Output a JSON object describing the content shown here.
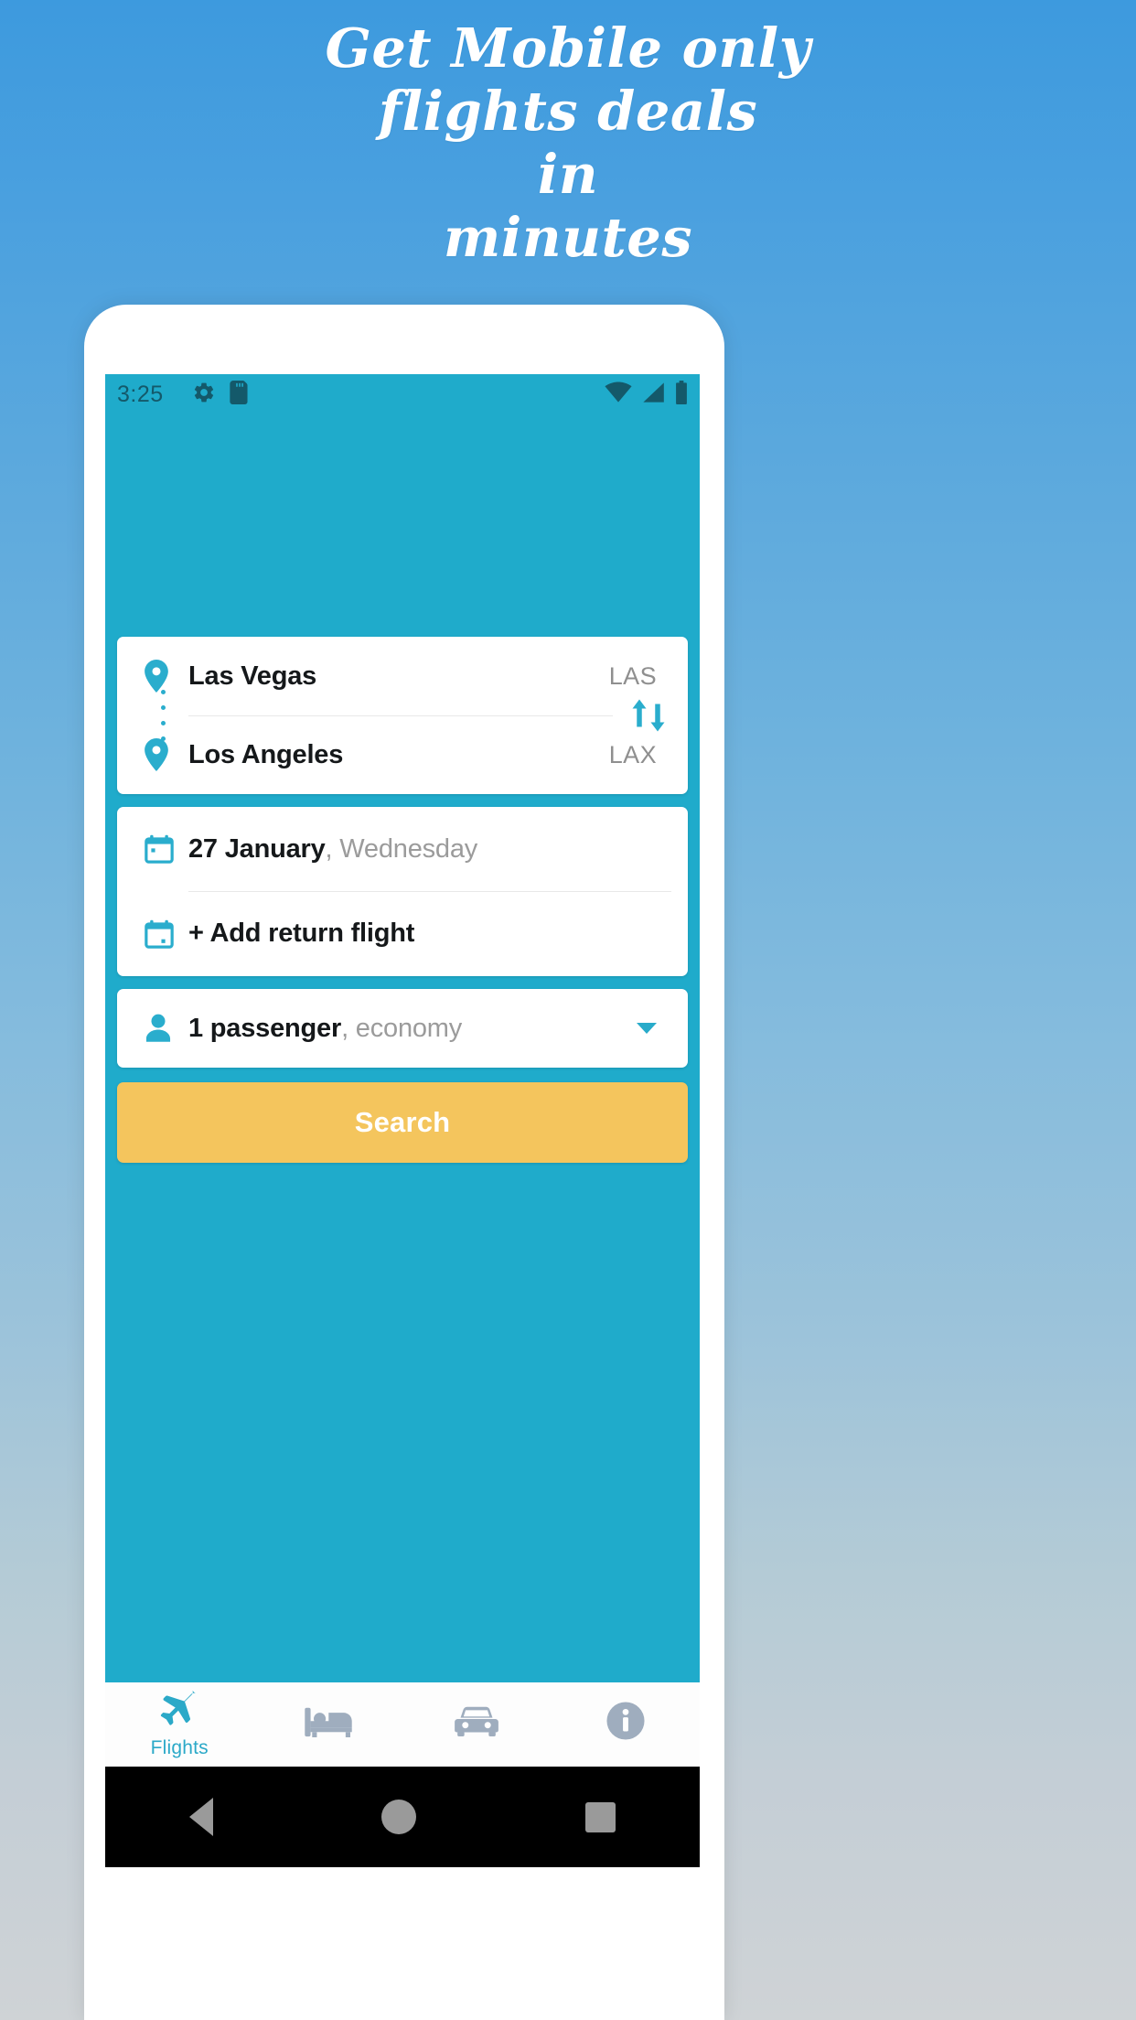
{
  "promo": {
    "lines": [
      "Get Mobile only",
      "flights deals",
      "in",
      "minutes"
    ]
  },
  "colors": {
    "app_teal": "#1fabcb",
    "accent_yellow": "#f4c55d",
    "icon_teal": "#2aadcd",
    "muted_gray": "#9b9b9b",
    "bg_top_blue": "#3d9ade",
    "bg_bottom_gray": "#cfd3d6"
  },
  "status_bar": {
    "time": "3:25",
    "left_icons": [
      "gear-icon",
      "sd-card-icon"
    ],
    "right_icons": [
      "wifi-icon",
      "cellular-signal-icon",
      "battery-icon"
    ]
  },
  "route_card": {
    "origin": {
      "city": "Las Vegas",
      "code": "LAS",
      "icon": "location-pin-icon"
    },
    "destination": {
      "city": "Los Angeles",
      "code": "LAX",
      "icon": "location-pin-icon"
    },
    "swap_icon": "swap-vertical-icon"
  },
  "dates_card": {
    "depart": {
      "date": "27 January",
      "separator": ", ",
      "weekday": "Wednesday",
      "icon": "calendar-icon"
    },
    "return": {
      "label": "+ Add return flight",
      "icon": "calendar-icon"
    }
  },
  "passengers_card": {
    "count_label": "1 passenger",
    "separator": ", ",
    "cabin_class": "economy",
    "icon": "person-icon",
    "dropdown_icon": "chevron-down-icon"
  },
  "search": {
    "label": "Search"
  },
  "tabs": [
    {
      "label": "Flights",
      "icon": "airplane-icon",
      "active": true
    },
    {
      "label": "",
      "icon": "hotel-bed-icon",
      "active": false
    },
    {
      "label": "",
      "icon": "car-icon",
      "active": false
    },
    {
      "label": "",
      "icon": "info-icon",
      "active": false
    }
  ],
  "android_nav": {
    "back": "back-triangle-icon",
    "home": "home-circle-icon",
    "recents": "recents-square-icon"
  }
}
